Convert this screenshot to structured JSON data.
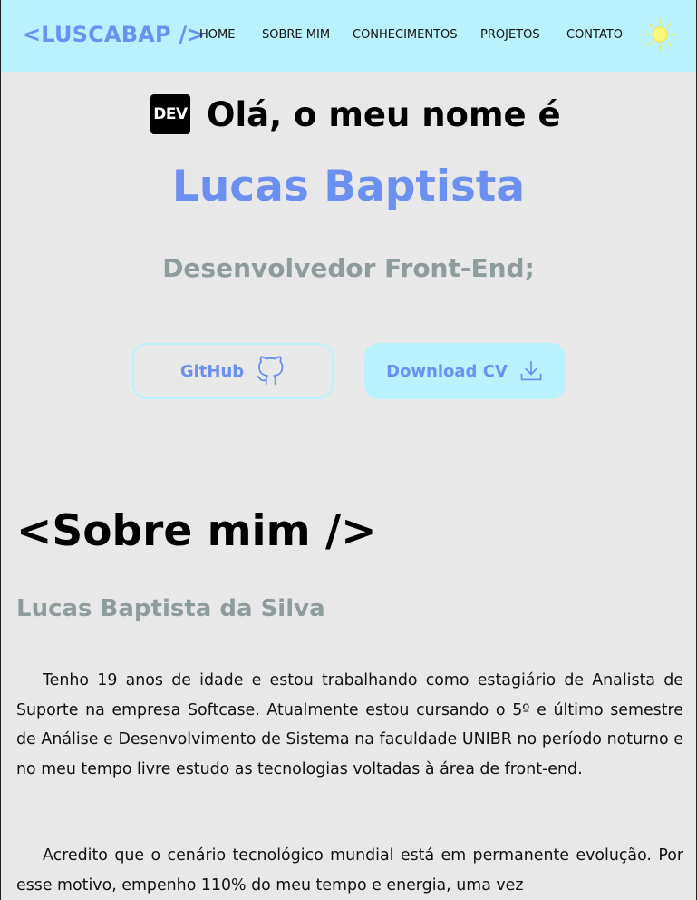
{
  "header": {
    "logo": "<LUSCABAP />",
    "nav": [
      "HOME",
      "SOBRE MIM",
      "CONHECIMENTOS",
      "PROJETOS",
      "CONTATO"
    ],
    "theme_icon": "sun-icon"
  },
  "hero": {
    "badge": "DEV",
    "greeting": "Olá, o meu nome é",
    "name": "Lucas Baptista",
    "role": "Desenvolvedor Front-End;",
    "buttons": {
      "github": "GitHub",
      "github_icon": "github-icon",
      "cv": "Download CV",
      "cv_icon": "download-icon"
    }
  },
  "about": {
    "title": "<Sobre mim />",
    "full_name": "Lucas Baptista da Silva",
    "paragraphs": [
      "Tenho 19 anos de idade e estou trabalhando como estagiário de Analista de Suporte na empresa Softcase. Atualmente estou cursando o 5º e último semestre de Análise e Desenvolvimento de Sistema na faculdade UNIBR no período noturno e no meu tempo livre estudo as tecnologias voltadas à área de front-end.",
      "Acredito que o cenário tecnológico mundial está em permanente evolução. Por esse motivo, empenho 110% do meu tempo e energia, uma vez"
    ]
  },
  "colors": {
    "header_bg": "#b9f1fd",
    "accent": "#6b90ef",
    "muted": "#8f9c9e",
    "page_bg": "#e8e8e8",
    "sun": "#f7f77a"
  }
}
